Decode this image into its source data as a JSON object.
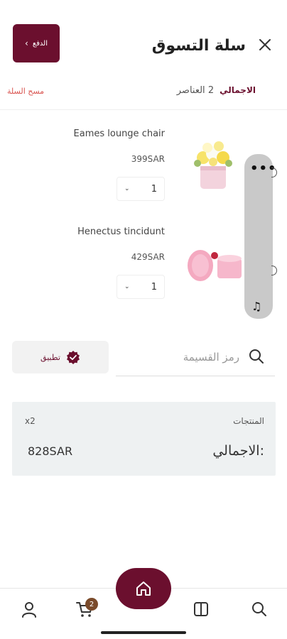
{
  "header": {
    "title": "سلة التسوق",
    "pay_label": "الدفع",
    "colors": {
      "brand": "#6b0f2e"
    }
  },
  "summary_row": {
    "total_label": "الاجمالي",
    "items_count": "2 العناصر",
    "clear_cart": "مسح السلة"
  },
  "cart_items": [
    {
      "name": "Eames lounge chair",
      "price": "399SAR",
      "quantity": "1",
      "image": "flower-box-image"
    },
    {
      "name": "Henectus tincidunt",
      "price": "429SAR",
      "quantity": "1",
      "image": "pink-box-image"
    }
  ],
  "coupon": {
    "placeholder": "رمز القسيمة",
    "apply_label": "تطبيق"
  },
  "summary_box": {
    "products_label": "المنتجات",
    "products_count": "x2",
    "total_label": "الاجمالي:",
    "total_value": "828SAR"
  },
  "bottom_nav": {
    "cart_badge": "2",
    "items": [
      "profile-icon",
      "cart-icon",
      "home-icon",
      "categories-icon",
      "search-icon"
    ]
  }
}
